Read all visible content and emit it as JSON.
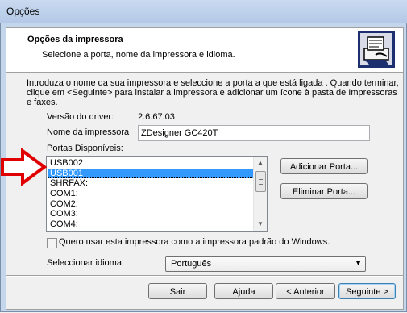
{
  "window": {
    "title": "Opções"
  },
  "header": {
    "title": "Opções da impressora",
    "subtitle": "Selecione a porta, nome da impressora e idioma.",
    "icon": "printer-wizard-icon"
  },
  "intro_text": "Introduza o nome da sua impressora e seleccione a porta a que está ligada . Quando terminar, clique em <Seguinte> para instalar a impressora e adicionar um ícone à pasta de Impressoras e faxes.",
  "driver": {
    "label": "Versão do driver:",
    "value": "2.6.67.03"
  },
  "printer_name": {
    "label": "Nome da impressora",
    "value": "ZDesigner GC420T"
  },
  "ports": {
    "label": "Portas Disponíveis:",
    "items": [
      "USB002",
      "USB001",
      "SHRFAX:",
      "COM1:",
      "COM2:",
      "COM3:",
      "COM4:"
    ],
    "selected": "USB001"
  },
  "buttons": {
    "add_port": "Adicionar Porta...",
    "delete_port": "Eliminar Porta...",
    "exit": "Sair",
    "help": "Ajuda",
    "back": "< Anterior",
    "next": "Seguinte >"
  },
  "default_printer": {
    "label": "Quero usar esta impressora como a impressora padrão do Windows.",
    "checked": false
  },
  "language": {
    "label": "Seleccionar idioma:",
    "value": "Português"
  },
  "colors": {
    "selection": "#3399ff",
    "annotation_arrow": "#e00000"
  }
}
